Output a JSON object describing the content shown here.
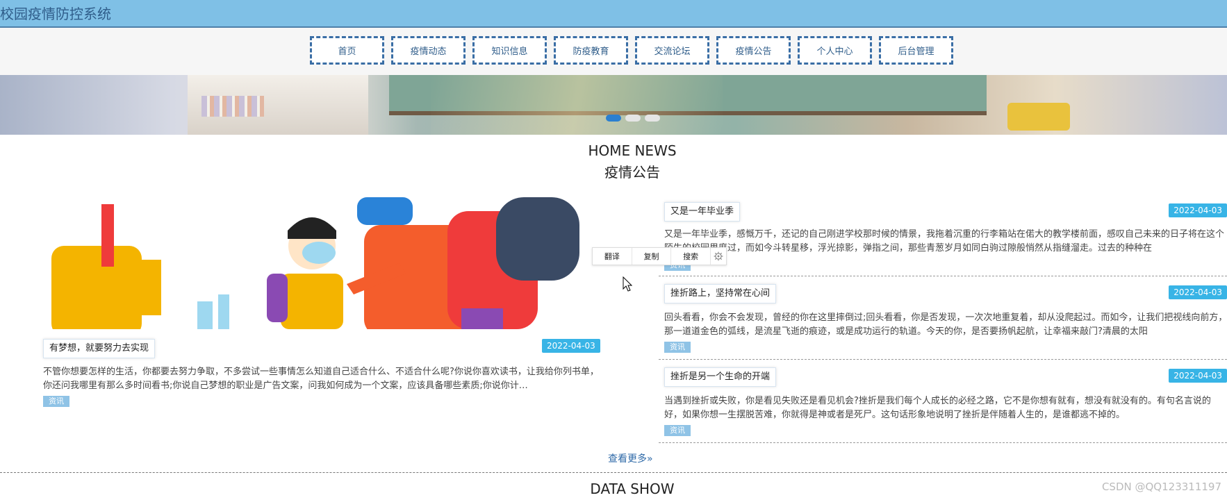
{
  "header": {
    "site_title": "校园疫情防控系统",
    "nav": [
      {
        "label": "首页"
      },
      {
        "label": "疫情动态"
      },
      {
        "label": "知识信息"
      },
      {
        "label": "防疫教育"
      },
      {
        "label": "交流论坛"
      },
      {
        "label": "疫情公告"
      },
      {
        "label": "个人中心"
      },
      {
        "label": "后台管理"
      }
    ]
  },
  "banner": {
    "dots": [
      {
        "active": true
      },
      {
        "active": false
      },
      {
        "active": false
      }
    ]
  },
  "section_news": {
    "title_en": "HOME NEWS",
    "title_cn": "疫情公告",
    "featured": {
      "title": "有梦想，就要努力去实现",
      "date": "2022-04-03",
      "desc": "不管你想要怎样的生活，你都要去努力争取，不多尝试一些事情怎么知道自己适合什么、不适合什么呢?你说你喜欢读书，让我给你列书单，你还问我哪里有那么多时间看书;你说自己梦想的职业是广告文案，问我如何成为一个文案，应该具备哪些素质;你说你计…",
      "tag": "资讯"
    },
    "items": [
      {
        "title": "又是一年毕业季",
        "date": "2022-04-03",
        "desc": "又是一年毕业季，感慨万千，还记的自己刚进学校那时候的情景，我拖着沉重的行李箱站在偌大的教学楼前面，感叹自己未来的日子将在这个陌生的校园里度过，而如今斗转星移，浮光掠影，弹指之间，那些青葱岁月如同白驹过隙般悄然从指缝溜走。过去的种种在",
        "tag": "资讯"
      },
      {
        "title": "挫折路上，坚持常在心间",
        "date": "2022-04-03",
        "desc": "回头看看，你会不会发现，曾经的你在这里摔倒过;回头看看，你是否发现，一次次地重复着，却从没爬起过。而如今，让我们把视线向前方，那一道道金色的弧线，是流星飞逝的痕迹，或是成功运行的轨道。今天的你，是否要扬帆起航，让幸福来敲门?清晨的太阳",
        "tag": "资讯"
      },
      {
        "title": "挫折是另一个生命的开端",
        "date": "2022-04-03",
        "desc": "当遇到挫折或失败，你是看见失败还是看见机会?挫折是我们每个人成长的必经之路，它不是你想有就有，想没有就没有的。有句名言说的好，如果你想一生摆脱苦难，你就得是神或者是死尸。这句话形象地说明了挫折是伴随着人生的，是谁都逃不掉的。",
        "tag": "资讯"
      }
    ],
    "more_label": "查看更多»"
  },
  "popup": {
    "translate": "翻译",
    "copy": "复制",
    "search": "搜索",
    "settings_icon": "gear-icon"
  },
  "section_data": {
    "title_en": "DATA SHOW"
  },
  "watermark": "CSDN @QQ123311197",
  "colors": {
    "topbar": "#7fc0e6",
    "nav_border": "#3a6ea5",
    "date_badge": "#38b4e6",
    "tag": "#8fc3e6"
  }
}
